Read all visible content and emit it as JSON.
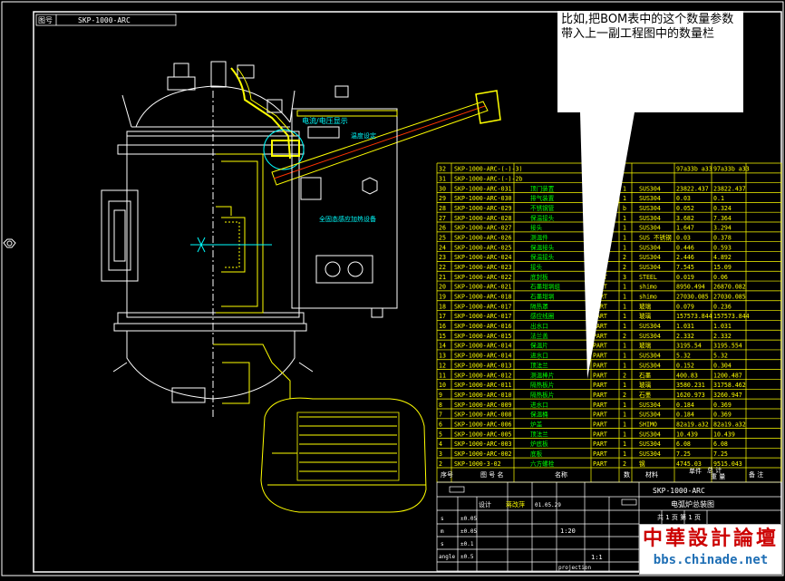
{
  "title_block_top": {
    "label": "图号",
    "drawing_no": "SKP-1000-ARC"
  },
  "callout": {
    "line1": "比如,把BOM表中的这个数量参数",
    "line2": "带入上一副工程图中的数量栏"
  },
  "panel": {
    "label1": "电流/电压显示",
    "label2": "温度设定",
    "label3": "全固态感应加热设备"
  },
  "bom": {
    "rows": [
      {
        "no": "32",
        "code": "SKP-1000-ARC-(-)-3)",
        "name": "",
        "type": "",
        "qty": "",
        "mat": "",
        "unit": "97a33b a33",
        "total": "97a33b a33"
      },
      {
        "no": "31",
        "code": "SKP-1000-ARC-(-)-2b",
        "name": "",
        "type": "",
        "qty": "",
        "mat": "",
        "unit": "",
        "total": ""
      },
      {
        "no": "30",
        "code": "SKP-1000-ARC-031",
        "name": "顶门装置",
        "type": "",
        "qty": "1",
        "mat": "SUS304",
        "unit": "23822.437",
        "total": "23822.437"
      },
      {
        "no": "29",
        "code": "SKP-1000-ARC-030",
        "name": "排气装置",
        "type": "",
        "qty": "1",
        "mat": "SUS304",
        "unit": "0.03",
        "total": "0.1"
      },
      {
        "no": "28",
        "code": "SKP-1000-ARC-029",
        "name": "不锈钢管",
        "type": "",
        "qty": "b",
        "mat": "SUS304",
        "unit": "0.052",
        "total": "0.324"
      },
      {
        "no": "27",
        "code": "SKP-1000-ARC-028",
        "name": "保温接头",
        "type": "",
        "qty": "1",
        "mat": "SUS304",
        "unit": "3.682",
        "total": "7.364"
      },
      {
        "no": "26",
        "code": "SKP-1000-ARC-027",
        "name": "接头",
        "type": "",
        "qty": "1",
        "mat": "SUS304",
        "unit": "1.647",
        "total": "3.294"
      },
      {
        "no": "25",
        "code": "SKP-1000-ARC-026",
        "name": "测温件",
        "type": "",
        "qty": "1",
        "mat": "SUS 不锈钢",
        "unit": "0.03",
        "total": "0.378"
      },
      {
        "no": "24",
        "code": "SKP-1000-ARC-025",
        "name": "保温接头",
        "type": "",
        "qty": "1",
        "mat": "SUS304",
        "unit": "0.446",
        "total": "0.593"
      },
      {
        "no": "23",
        "code": "SKP-1000-ARC-024",
        "name": "保温接头",
        "type": "",
        "qty": "2",
        "mat": "SUS304",
        "unit": "2.446",
        "total": "4.892"
      },
      {
        "no": "22",
        "code": "SKP-1000-ARC-023",
        "name": "接头",
        "type": "",
        "qty": "2",
        "mat": "SUS304",
        "unit": "7.545",
        "total": "15.09"
      },
      {
        "no": "21",
        "code": "SKP-1000-ARC-022",
        "name": "底封板",
        "type": "PART",
        "qty": "3",
        "mat": "STEEL",
        "unit": "0.019",
        "total": "0.06"
      },
      {
        "no": "20",
        "code": "SKP-1000-ARC-021",
        "name": "石墨坩埚组",
        "type": "PART",
        "qty": "1",
        "mat": "shimo",
        "unit": "8950.494",
        "total": "26870.082"
      },
      {
        "no": "19",
        "code": "SKP-1000-ARC-018",
        "name": "石墨坩埚",
        "type": "PART",
        "qty": "1",
        "mat": "shimo",
        "unit": "27030.085",
        "total": "27030.085"
      },
      {
        "no": "18",
        "code": "SKP-1000-ARC-017",
        "name": "隔热罩",
        "type": "PART",
        "qty": "1",
        "mat": "玻璃",
        "unit": "0.079",
        "total": "0.236"
      },
      {
        "no": "17",
        "code": "SKP-1000-ARC-017",
        "name": "感应线圈",
        "type": "PART",
        "qty": "1",
        "mat": "玻璃",
        "unit": "157573.844",
        "total": "157573.844"
      },
      {
        "no": "16",
        "code": "SKP-1000-ARC-016",
        "name": "出水口",
        "type": "PART",
        "qty": "1",
        "mat": "SUS304",
        "unit": "1.031",
        "total": "1.031"
      },
      {
        "no": "15",
        "code": "SKP-1000-ARC-015",
        "name": "法兰盖",
        "type": "PART",
        "qty": "2",
        "mat": "SUS304",
        "unit": "2.332",
        "total": "2.332"
      },
      {
        "no": "14",
        "code": "SKP-1000-ARC-014",
        "name": "保温片",
        "type": "PART",
        "qty": "1",
        "mat": "玻璃",
        "unit": "3195.54",
        "total": "3195.554"
      },
      {
        "no": "13",
        "code": "SKP-1000-ARC-014",
        "name": "进水口",
        "type": "PART",
        "qty": "1",
        "mat": "SUS304",
        "unit": "5.32",
        "total": "5.32"
      },
      {
        "no": "12",
        "code": "SKP-1000-ARC-013",
        "name": "顶法兰",
        "type": "PART",
        "qty": "1",
        "mat": "SUS304",
        "unit": "0.152",
        "total": "0.304"
      },
      {
        "no": "11",
        "code": "SKP-1000-ARC-012",
        "name": "测温棒片",
        "type": "PART",
        "qty": "2",
        "mat": "石墨",
        "unit": "400.83",
        "total": "1200.487"
      },
      {
        "no": "10",
        "code": "SKP-1000-ARC-011",
        "name": "隔热板片",
        "type": "PART",
        "qty": "1",
        "mat": "玻璃",
        "unit": "3580.231",
        "total": "31758.462"
      },
      {
        "no": "9",
        "code": "SKP-1000-ARC-010",
        "name": "隔热板片",
        "type": "PART",
        "qty": "2",
        "mat": "石墨",
        "unit": "1620.973",
        "total": "3260.947"
      },
      {
        "no": "8",
        "code": "SKP-1000-ARC-009",
        "name": "进水口",
        "type": "PART",
        "qty": "1",
        "mat": "SUS304",
        "unit": "0.184",
        "total": "0.369"
      },
      {
        "no": "7",
        "code": "SKP-1000-ARC-008",
        "name": "保温桶",
        "type": "PART",
        "qty": "1",
        "mat": "SUS304",
        "unit": "0.184",
        "total": "0.369"
      },
      {
        "no": "6",
        "code": "SKP-1000-ARC-006",
        "name": "炉盖",
        "type": "PART",
        "qty": "1",
        "mat": "SHIMO",
        "unit": "82a19.a32",
        "total": "82a19.a32"
      },
      {
        "no": "5",
        "code": "SKP-1000-ARC-005",
        "name": "顶法兰",
        "type": "PART",
        "qty": "1",
        "mat": "SUS304",
        "unit": "10.439",
        "total": "10.439"
      },
      {
        "no": "4",
        "code": "SKP-1000-ARC-003",
        "name": "炉底板",
        "type": "PART",
        "qty": "1",
        "mat": "SUS304",
        "unit": "6.08",
        "total": "6.08"
      },
      {
        "no": "3",
        "code": "SKP-1000-ARC-002",
        "name": "底板",
        "type": "PART",
        "qty": "1",
        "mat": "SUS304",
        "unit": "7.25",
        "total": "7.25"
      },
      {
        "no": "2",
        "code": "SKP-1000-3-02",
        "name": "六方螺栓",
        "type": "PART",
        "qty": "2",
        "mat": "钢",
        "unit": "4745.03",
        "total": "9515.043"
      }
    ],
    "header": {
      "no": "序号",
      "code": "图 号 名",
      "name": "名称",
      "type": "",
      "qty": "数",
      "mat": "材料",
      "unit": "单件",
      "total": "总 计",
      "remark": "备 注",
      "weight": "重 量"
    }
  },
  "title_block": {
    "drawing_no": "SKP-1000-ARC",
    "drawing_name": "电弧炉总装图",
    "designer_label": "设计",
    "designer": "蒋改萍",
    "date": "01.05.29",
    "scale": "1:1",
    "scale2": "1:20",
    "sheet": "共 1 页 第 1 页",
    "projection": "projection",
    "tolerances": [
      {
        "label": "s",
        "v1": "±0.05"
      },
      {
        "label": "m",
        "v1": "±0.05"
      },
      {
        "label": "s",
        "v1": "±0.1"
      },
      {
        "label": "angle",
        "v1": "±0.5"
      }
    ]
  },
  "watermark": {
    "line1": "中華設計論壇",
    "line2": "bbs.chinade.net"
  },
  "colors": {
    "background": "#000000",
    "frame": "#ffffff",
    "line": "#ffff00",
    "aux": "#00ffff",
    "text": "#00ff00",
    "accent": "#ff0000"
  }
}
